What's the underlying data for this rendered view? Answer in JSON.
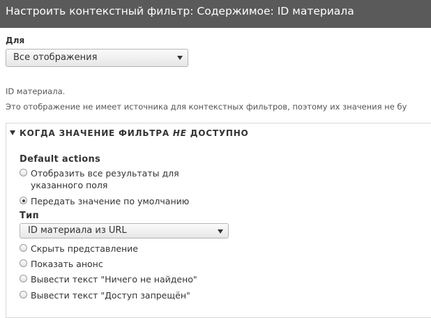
{
  "dialog": {
    "title": "Настроить контекстный фильтр: Содержимое: ID материала"
  },
  "for_field": {
    "label": "Для",
    "selected": "Все отображения"
  },
  "description": {
    "line1": "ID материала.",
    "line2": "Это отображение не имеет источника для контекстных фильтров, поэтому их значения не бу"
  },
  "fieldset": {
    "legend_before": "КОГДА ЗНАЧЕНИЕ ФИЛЬТРА ",
    "legend_em": "НЕ",
    "legend_after": " ДОСТУПНО",
    "default_actions_label": "Default actions",
    "options": [
      {
        "line1": "Отобразить все результаты для",
        "line2": "указанного поля",
        "checked": false
      },
      {
        "line1": "Передать значение по умолчанию",
        "checked": true
      },
      {
        "line1": "Скрыть представление",
        "checked": false
      },
      {
        "line1": "Показать анонс",
        "checked": false
      },
      {
        "line1": "Вывести текст \"Ничего не найдено\"",
        "checked": false
      },
      {
        "line1": "Вывести текст \"Доступ запрещён\"",
        "checked": false
      }
    ],
    "type_label": "Тип",
    "type_selected": "ID материала из URL"
  }
}
